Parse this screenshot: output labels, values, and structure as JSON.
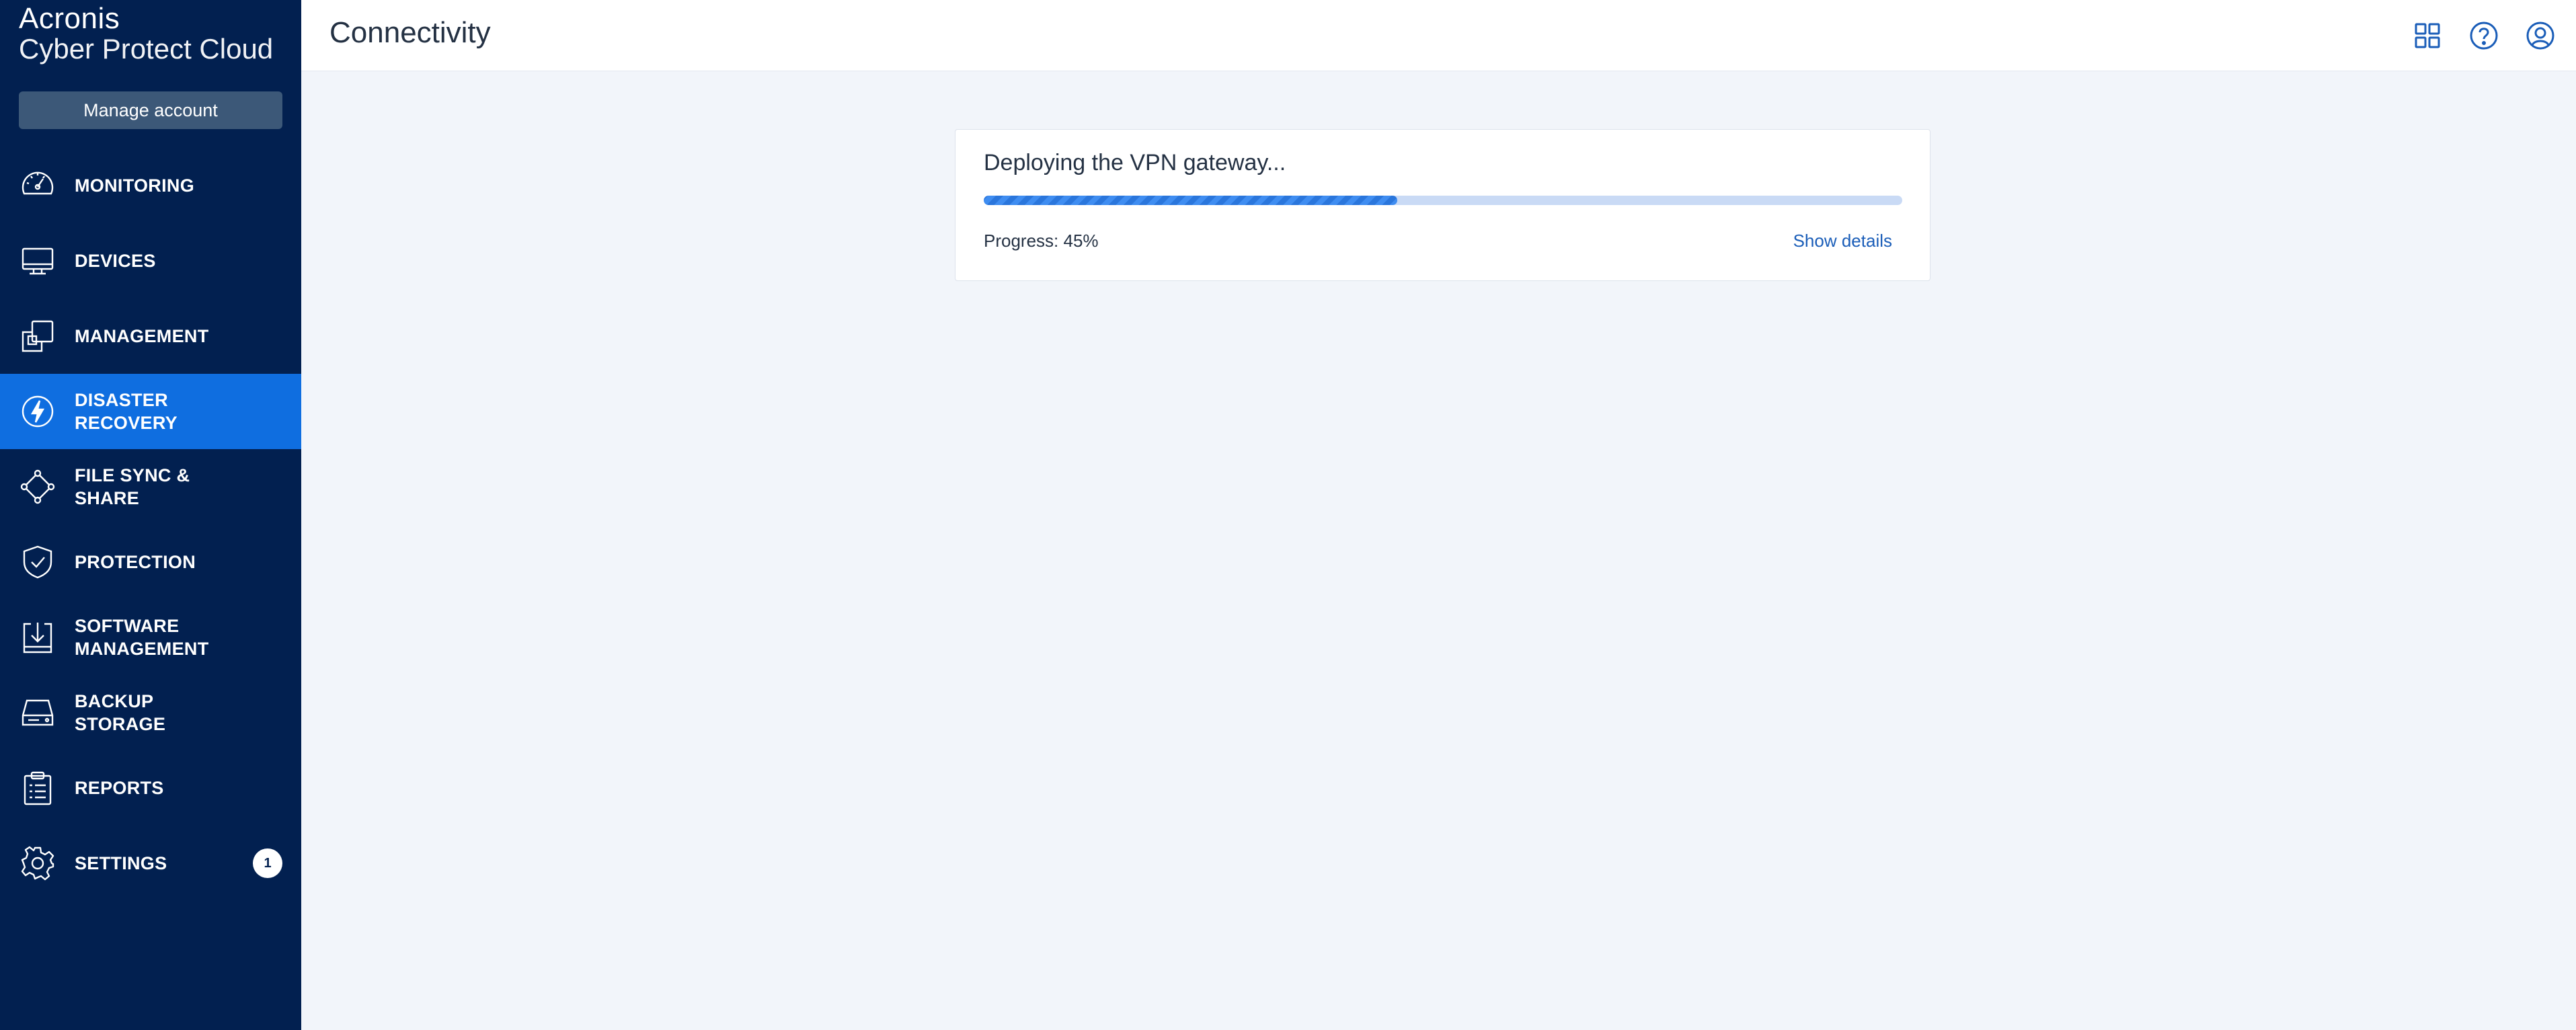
{
  "brand": {
    "name": "Acronis",
    "product": "Cyber Protect Cloud"
  },
  "sidebar": {
    "manage_account": "Manage account",
    "items": [
      {
        "label": "MONITORING",
        "icon": "gauge-icon"
      },
      {
        "label": "DEVICES",
        "icon": "monitor-icon"
      },
      {
        "label": "MANAGEMENT",
        "icon": "copy-icon"
      },
      {
        "label": "DISASTER RECOVERY",
        "icon": "lightning-icon",
        "active": true
      },
      {
        "label": "FILE SYNC & SHARE",
        "icon": "share-icon"
      },
      {
        "label": "PROTECTION",
        "icon": "shield-icon"
      },
      {
        "label": "SOFTWARE MANAGEMENT",
        "icon": "download-icon"
      },
      {
        "label": "BACKUP STORAGE",
        "icon": "drive-icon"
      },
      {
        "label": "REPORTS",
        "icon": "clipboard-icon"
      },
      {
        "label": "SETTINGS",
        "icon": "gear-icon",
        "badge": "1"
      }
    ]
  },
  "header": {
    "title": "Connectivity",
    "icons": [
      "grid-icon",
      "help-icon",
      "user-icon"
    ]
  },
  "deploy_card": {
    "title": "Deploying the VPN gateway...",
    "progress_percent": 45,
    "progress_text": "Progress: 45%",
    "show_details": "Show details"
  },
  "colors": {
    "sidebar_bg": "#022050",
    "active_item": "#0f6ee0",
    "page_bg": "#f2f5fa",
    "link": "#1a5db8",
    "progress": "#3f8df1"
  }
}
